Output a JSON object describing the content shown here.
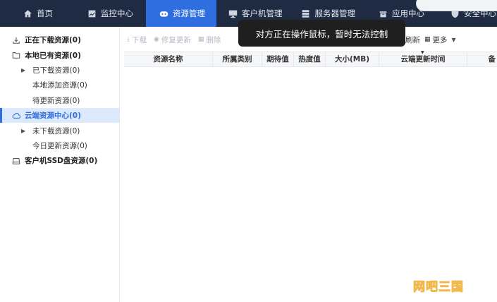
{
  "nav": {
    "items": [
      {
        "label": "首页",
        "icon": "home-icon"
      },
      {
        "label": "监控中心",
        "icon": "monitor-chart-icon"
      },
      {
        "label": "资源管理",
        "icon": "resource-icon",
        "active": true
      },
      {
        "label": "客户机管理",
        "icon": "desktop-icon"
      },
      {
        "label": "服务器管理",
        "icon": "server-icon"
      },
      {
        "label": "应用中心",
        "icon": "app-box-icon"
      },
      {
        "label": "安全中心",
        "icon": "shield-icon"
      }
    ]
  },
  "sidebar": {
    "items": [
      {
        "label": "正在下载资源(0)",
        "level": 0,
        "icon": "download-icon"
      },
      {
        "label": "本地已有资源(0)",
        "level": 0,
        "icon": "folder-icon"
      },
      {
        "label": "已下载资源(0)",
        "level": 1,
        "expandable": true
      },
      {
        "label": "本地添加资源(0)",
        "level": 1
      },
      {
        "label": "待更新资源(0)",
        "level": 1
      },
      {
        "label": "云端资源中心(0)",
        "level": 0,
        "icon": "cloud-icon",
        "selected": true
      },
      {
        "label": "未下载资源(0)",
        "level": 1,
        "expandable": true
      },
      {
        "label": "今日更新资源(0)",
        "level": 1
      },
      {
        "label": "客户机SSD盘资源(0)",
        "level": 0,
        "icon": "disk-icon"
      }
    ]
  },
  "toolbar": {
    "download": "下载",
    "repair_update": "修复更新",
    "delete": "删除",
    "refresh": "刷新",
    "more": "更多"
  },
  "table": {
    "columns": [
      "资源名称",
      "所属类别",
      "期待值",
      "热度值",
      "大小(MB)",
      "云端更新时间",
      "备"
    ]
  },
  "tooltip": {
    "text": "对方正在操作鼠标，暂时无法控制"
  },
  "watermark": {
    "text": "网吧三国"
  },
  "colors": {
    "nav_bg": "#1e2b43",
    "accent": "#2f6ee0",
    "selected_bg": "#dce8fb",
    "watermark": "#f0b23a"
  }
}
